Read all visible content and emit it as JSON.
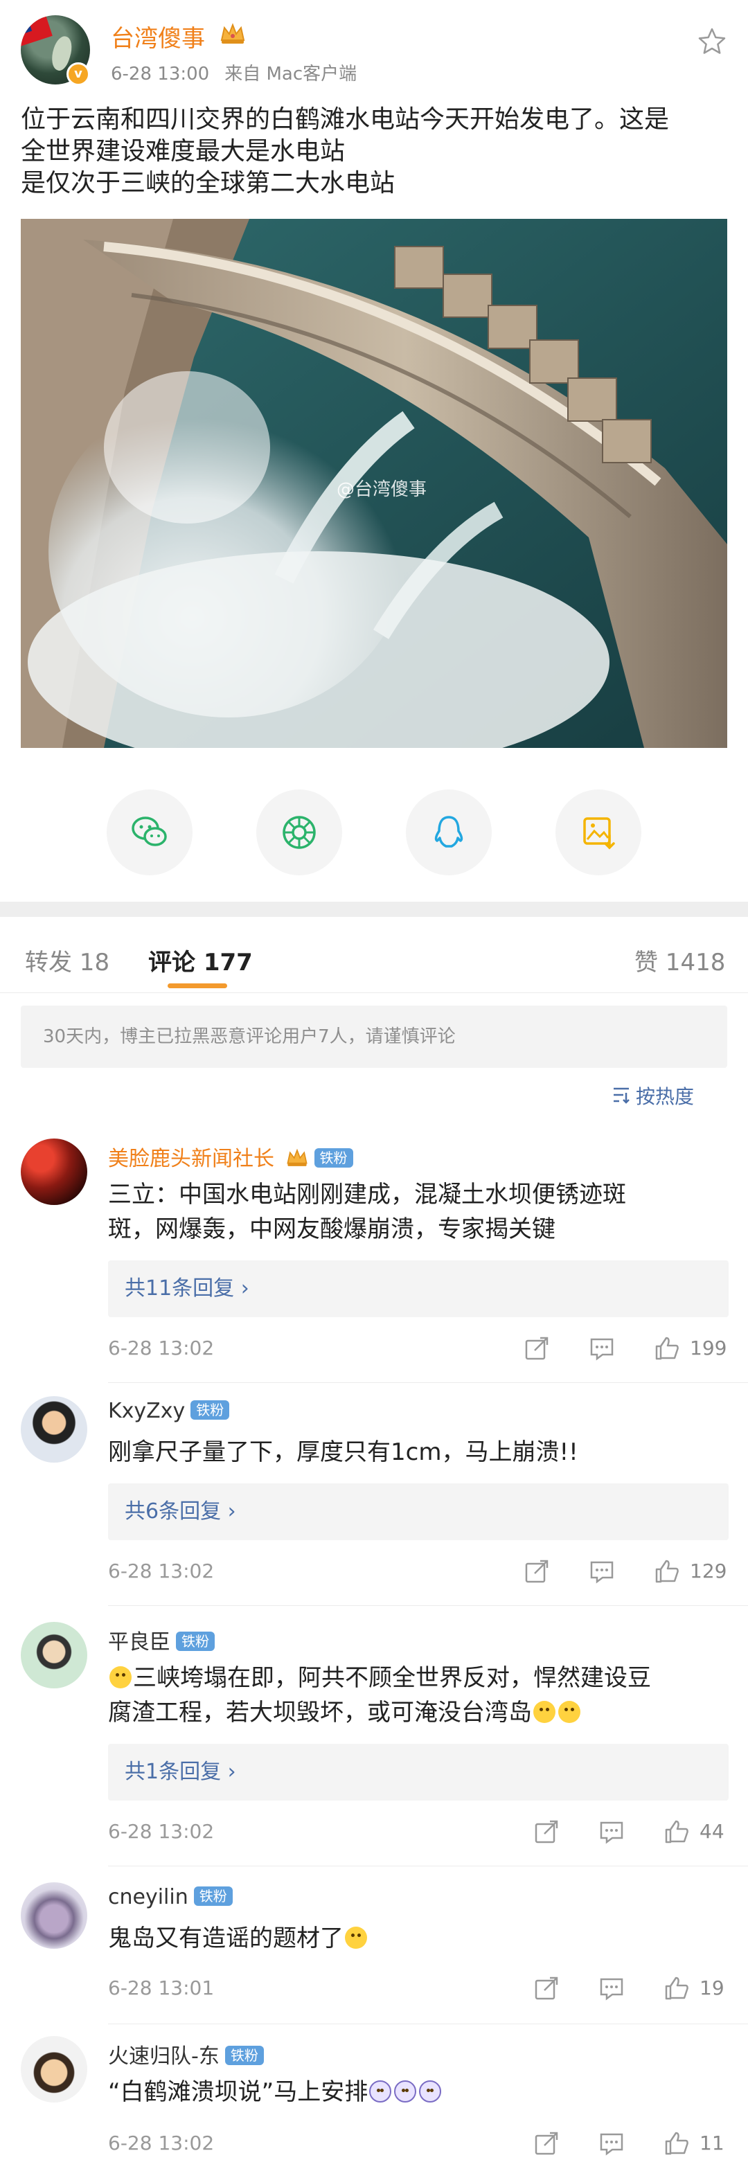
{
  "post": {
    "author": "台湾傻事",
    "time": "6-28 13:00",
    "source": "来自 Mac客户端",
    "text_lines": [
      "位于云南和四川交界的白鹤滩水电站今天开始发电了。这是",
      "全世界建设难度最大是水电站",
      "是仅次于三峡的全球第二大水电站"
    ],
    "watermark": "@台湾傻事"
  },
  "icons": {
    "star": "star-icon",
    "wechat": "wechat-icon",
    "moments": "moments-icon",
    "qq": "qq-icon",
    "save": "save-image-icon"
  },
  "tabs": {
    "repost": "转发 18",
    "comment": "评论 177",
    "like": "赞 1418"
  },
  "notice": "30天内，博主已拉黑恶意评论用户7人，请谨慎评论",
  "sort_label": "按热度",
  "colors": {
    "accent": "#f39a2d",
    "author_orange": "#f0801a",
    "link_blue": "#4a6ea8",
    "fan_badge": "#5ea0de"
  },
  "comments": [
    {
      "name": "美脸鹿头新闻社长",
      "name_color": "#f0801a",
      "badge": "铁粉",
      "text_lines": [
        "三立：中国水电站刚刚建成，混凝土水坝便锈迹斑",
        "斑，网爆轰，中网友酸爆崩溃，专家揭关键"
      ],
      "replies": "共11条回复 ›",
      "time": "6-28 13:02",
      "likes": "199"
    },
    {
      "name": "KxyZxy",
      "name_color": "#333333",
      "badge": "铁粉",
      "text_lines": [
        "刚拿尺子量了下，厚度只有1cm，马上崩溃!!"
      ],
      "replies": "共6条回复 ›",
      "time": "6-28 13:02",
      "likes": "129"
    },
    {
      "name": "平良臣",
      "name_color": "#333333",
      "badge": "铁粉",
      "text_lines": [
        "三峡垮塌在即，阿共不顾全世界反对，悍然建设豆",
        "腐渣工程，若大坝毁坏，或可淹没台湾岛"
      ],
      "replies": "共1条回复 ›",
      "time": "6-28 13:02",
      "likes": "44"
    },
    {
      "name": "cneyilin",
      "name_color": "#333333",
      "badge": "铁粉",
      "text_lines": [
        "鬼岛又有造谣的题材了"
      ],
      "replies": "",
      "time": "6-28 13:01",
      "likes": "19"
    },
    {
      "name": "火速归队-东",
      "name_color": "#333333",
      "badge": "铁粉",
      "text_lines": [
        "“白鹤滩溃坝说”马上安排"
      ],
      "replies": "",
      "time": "6-28 13:02",
      "likes": "11"
    }
  ]
}
